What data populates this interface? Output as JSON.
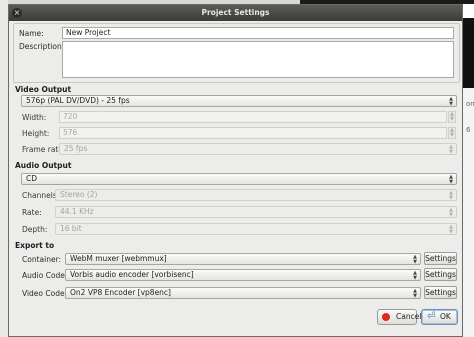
{
  "window": {
    "title": "Project Settings"
  },
  "background": {
    "side_mark_1": "on",
    "side_mark_2": "6"
  },
  "project": {
    "name_label": "Name:",
    "name_value": "New Project",
    "description_label": "Description:",
    "description_value": ""
  },
  "video_output": {
    "heading": "Video Output",
    "preset": "576p (PAL DV/DVD) - 25 fps",
    "width_label": "Width:",
    "width_value": "720",
    "height_label": "Height:",
    "height_value": "576",
    "frame_rate_label": "Frame rate:",
    "frame_rate_value": "25 fps"
  },
  "audio_output": {
    "heading": "Audio Output",
    "preset": "CD",
    "channels_label": "Channels:",
    "channels_value": "Stereo (2)",
    "rate_label": "Rate:",
    "rate_value": "44.1 KHz",
    "depth_label": "Depth:",
    "depth_value": "16 bit"
  },
  "export": {
    "heading": "Export to",
    "container_label": "Container:",
    "container_value": "WebM muxer [webmmux]",
    "audio_codec_label": "Audio Codec:",
    "audio_codec_value": "Vorbis audio encoder [vorbisenc]",
    "video_codec_label": "Video Codec:",
    "video_codec_value": "On2 VP8 Encoder [vp8enc]",
    "settings_label": "Settings"
  },
  "buttons": {
    "cancel_label": "Cancel",
    "ok_label": "OK"
  },
  "colors": {
    "titlebar": "#4a4a47",
    "dialog_bg": "#ececea",
    "cancel_icon": "#d92a1c",
    "ok_icon": "#3f6ea8"
  }
}
